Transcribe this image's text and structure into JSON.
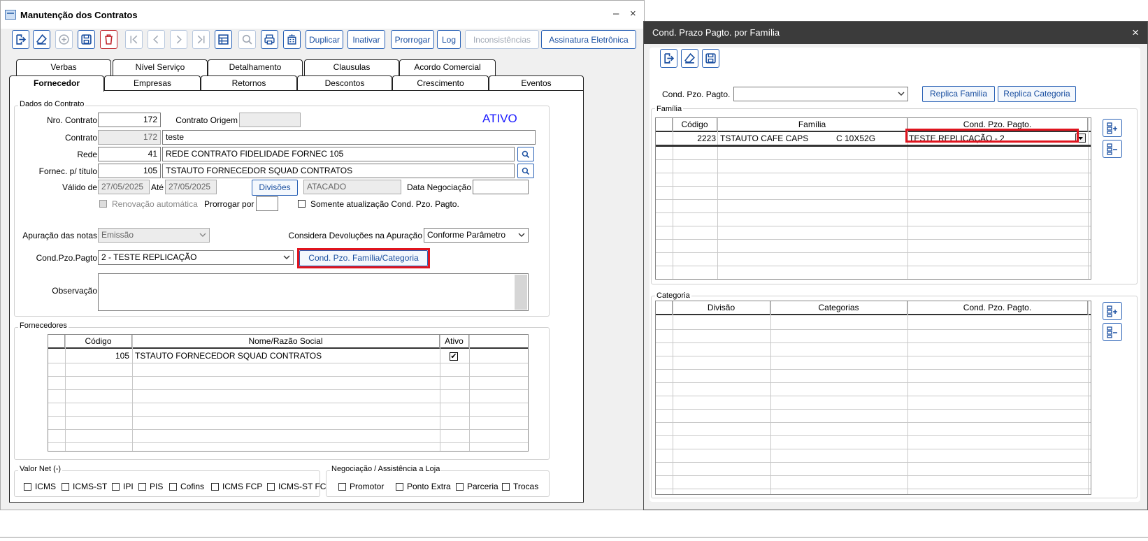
{
  "main_window": {
    "title": "Manutenção dos Contratos",
    "minimize": "–",
    "close": "×",
    "toolbar": {
      "duplicar": "Duplicar",
      "inativar": "Inativar",
      "prorrogar": "Prorrogar",
      "log": "Log",
      "inconsistencias": "Inconsistências",
      "assinatura": "Assinatura Eletrônica"
    },
    "tabs_row1": [
      "Verbas",
      "Nível Serviço",
      "Detalhamento",
      "Clausulas",
      "Acordo Comercial"
    ],
    "tabs_row2": [
      "Fornecedor",
      "Empresas",
      "Retornos",
      "Descontos",
      "Crescimento",
      "Eventos"
    ],
    "dados": {
      "group_title": "Dados do Contrato",
      "status": "ATIVO",
      "nro_contrato_label": "Nro. Contrato",
      "nro_contrato": "172",
      "contrato_origem_label": "Contrato Origem",
      "contrato_origem": "",
      "contrato_label": "Contrato",
      "contrato_num": "172",
      "contrato_desc": "teste",
      "rede_label": "Rede",
      "rede_code": "41",
      "rede_name": "REDE CONTRATO FIDELIDADE FORNEC 105",
      "fornec_label": "Fornec. p/ título",
      "fornec_code": "105",
      "fornec_name": "TSTAUTO FORNECEDOR SQUAD CONTRATOS",
      "valido_label": "Válido de",
      "valido_de": "27/05/2025",
      "ate_label": "Até",
      "ate": "27/05/2025",
      "divisoes_button": "Divisões",
      "divisao": "ATACADO",
      "data_negociacao_label": "Data Negociação",
      "data_negociacao": "",
      "renovacao_label": "Renovação automática",
      "prorrogar_por_label": "Prorrogar por",
      "somente_label": "Somente atualização Cond. Pzo. Pagto.",
      "apuracao_label": "Apuração das notas",
      "apuracao_value": "Emissão",
      "considera_label": "Considera Devoluções na Apuração",
      "considera_value": "Conforme Parâmetro",
      "cond_label": "Cond.Pzo.Pagto",
      "cond_value": "2 - TESTE REPLICAÇÃO",
      "cond_familia_button": "Cond. Pzo. Família/Categoria",
      "observacao_label": "Observação"
    },
    "fornecedores": {
      "group_title": "Fornecedores",
      "columns": [
        "Código",
        "Nome/Razão Social",
        "Ativo"
      ],
      "rows": [
        {
          "codigo": "105",
          "nome": "TSTAUTO FORNECEDOR SQUAD CONTRATOS",
          "ativo": "✔"
        }
      ]
    },
    "valor_net": {
      "group_title": "Valor Net (-)",
      "items": [
        "ICMS",
        "ICMS-ST",
        "IPI",
        "PIS",
        "Cofins",
        "ICMS FCP",
        "ICMS-ST FCP"
      ]
    },
    "negociacao": {
      "group_title": "Negociação / Assistência a Loja",
      "items": [
        "Promotor",
        "Ponto Extra",
        "Parceria",
        "Trocas"
      ]
    }
  },
  "dialog": {
    "title": "Cond. Prazo Pagto. por Família",
    "close": "×",
    "cond_label": "Cond. Pzo. Pagto.",
    "cond_value": "",
    "replica_familia": "Replica Familia",
    "replica_categoria": "Replica Categoria",
    "familia": {
      "group_title": "Família",
      "columns": [
        "Código",
        "Família",
        "Cond. Pzo. Pagto."
      ],
      "rows": [
        {
          "codigo": "2223",
          "familia": "TSTAUTO CAFE CAPS",
          "familia_extra": "C 10X52G",
          "cond": "TESTE REPLICAÇÃO - 2"
        }
      ]
    },
    "categoria": {
      "group_title": "Categoria",
      "columns": [
        "Divisão",
        "Categorias",
        "Cond. Pzo. Pagto."
      ],
      "rows": []
    }
  },
  "colors": {
    "accent": "#2a62b6",
    "status": "#1a1aff",
    "highlight": "#e0141e"
  }
}
